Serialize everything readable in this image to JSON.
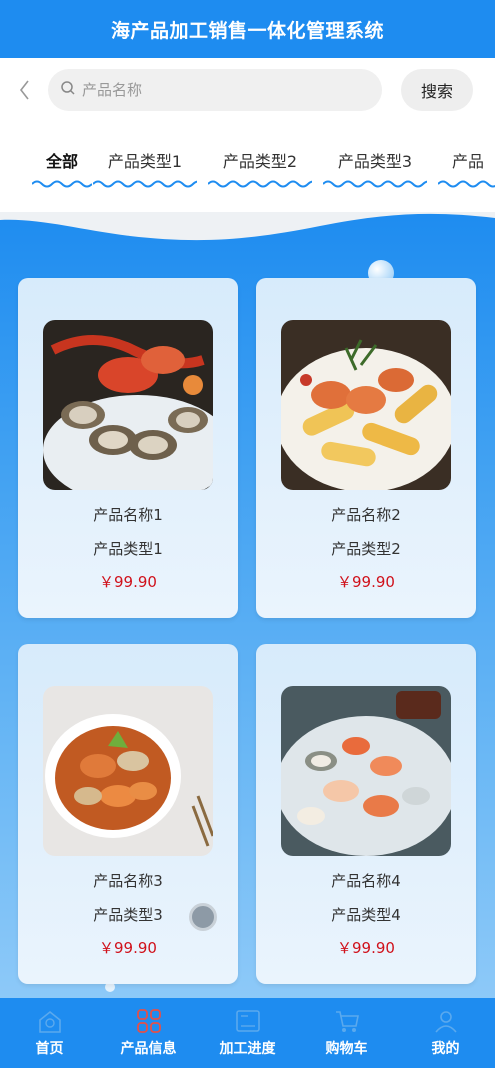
{
  "header": {
    "title": "海产品加工销售一体化管理系统"
  },
  "search": {
    "placeholder": "产品名称",
    "button_label": "搜索"
  },
  "tabs": [
    {
      "label": "全部",
      "active": true
    },
    {
      "label": "产品类型1"
    },
    {
      "label": "产品类型2"
    },
    {
      "label": "产品类型3"
    },
    {
      "label": "产品"
    }
  ],
  "products": [
    {
      "name": "产品名称1",
      "type": "产品类型1",
      "price": "￥99.90",
      "image": "seafood-platter-lobster-oysters"
    },
    {
      "name": "产品名称2",
      "type": "产品类型2",
      "price": "￥99.90",
      "image": "shrimp-pasta"
    },
    {
      "name": "产品名称3",
      "type": "产品类型3",
      "price": "￥99.90",
      "image": "seafood-pot"
    },
    {
      "name": "产品名称4",
      "type": "产品类型4",
      "price": "￥99.90",
      "image": "seafood-ice-platter"
    }
  ],
  "nav": [
    {
      "label": "首页",
      "icon": "home-icon"
    },
    {
      "label": "产品信息",
      "icon": "grid-icon",
      "active": true
    },
    {
      "label": "加工进度",
      "icon": "progress-icon"
    },
    {
      "label": "购物车",
      "icon": "cart-icon"
    },
    {
      "label": "我的",
      "icon": "user-icon"
    }
  ],
  "colors": {
    "primary": "#1e8cf0",
    "price": "#d0111b",
    "nav_active_icon": "#e3504a"
  }
}
